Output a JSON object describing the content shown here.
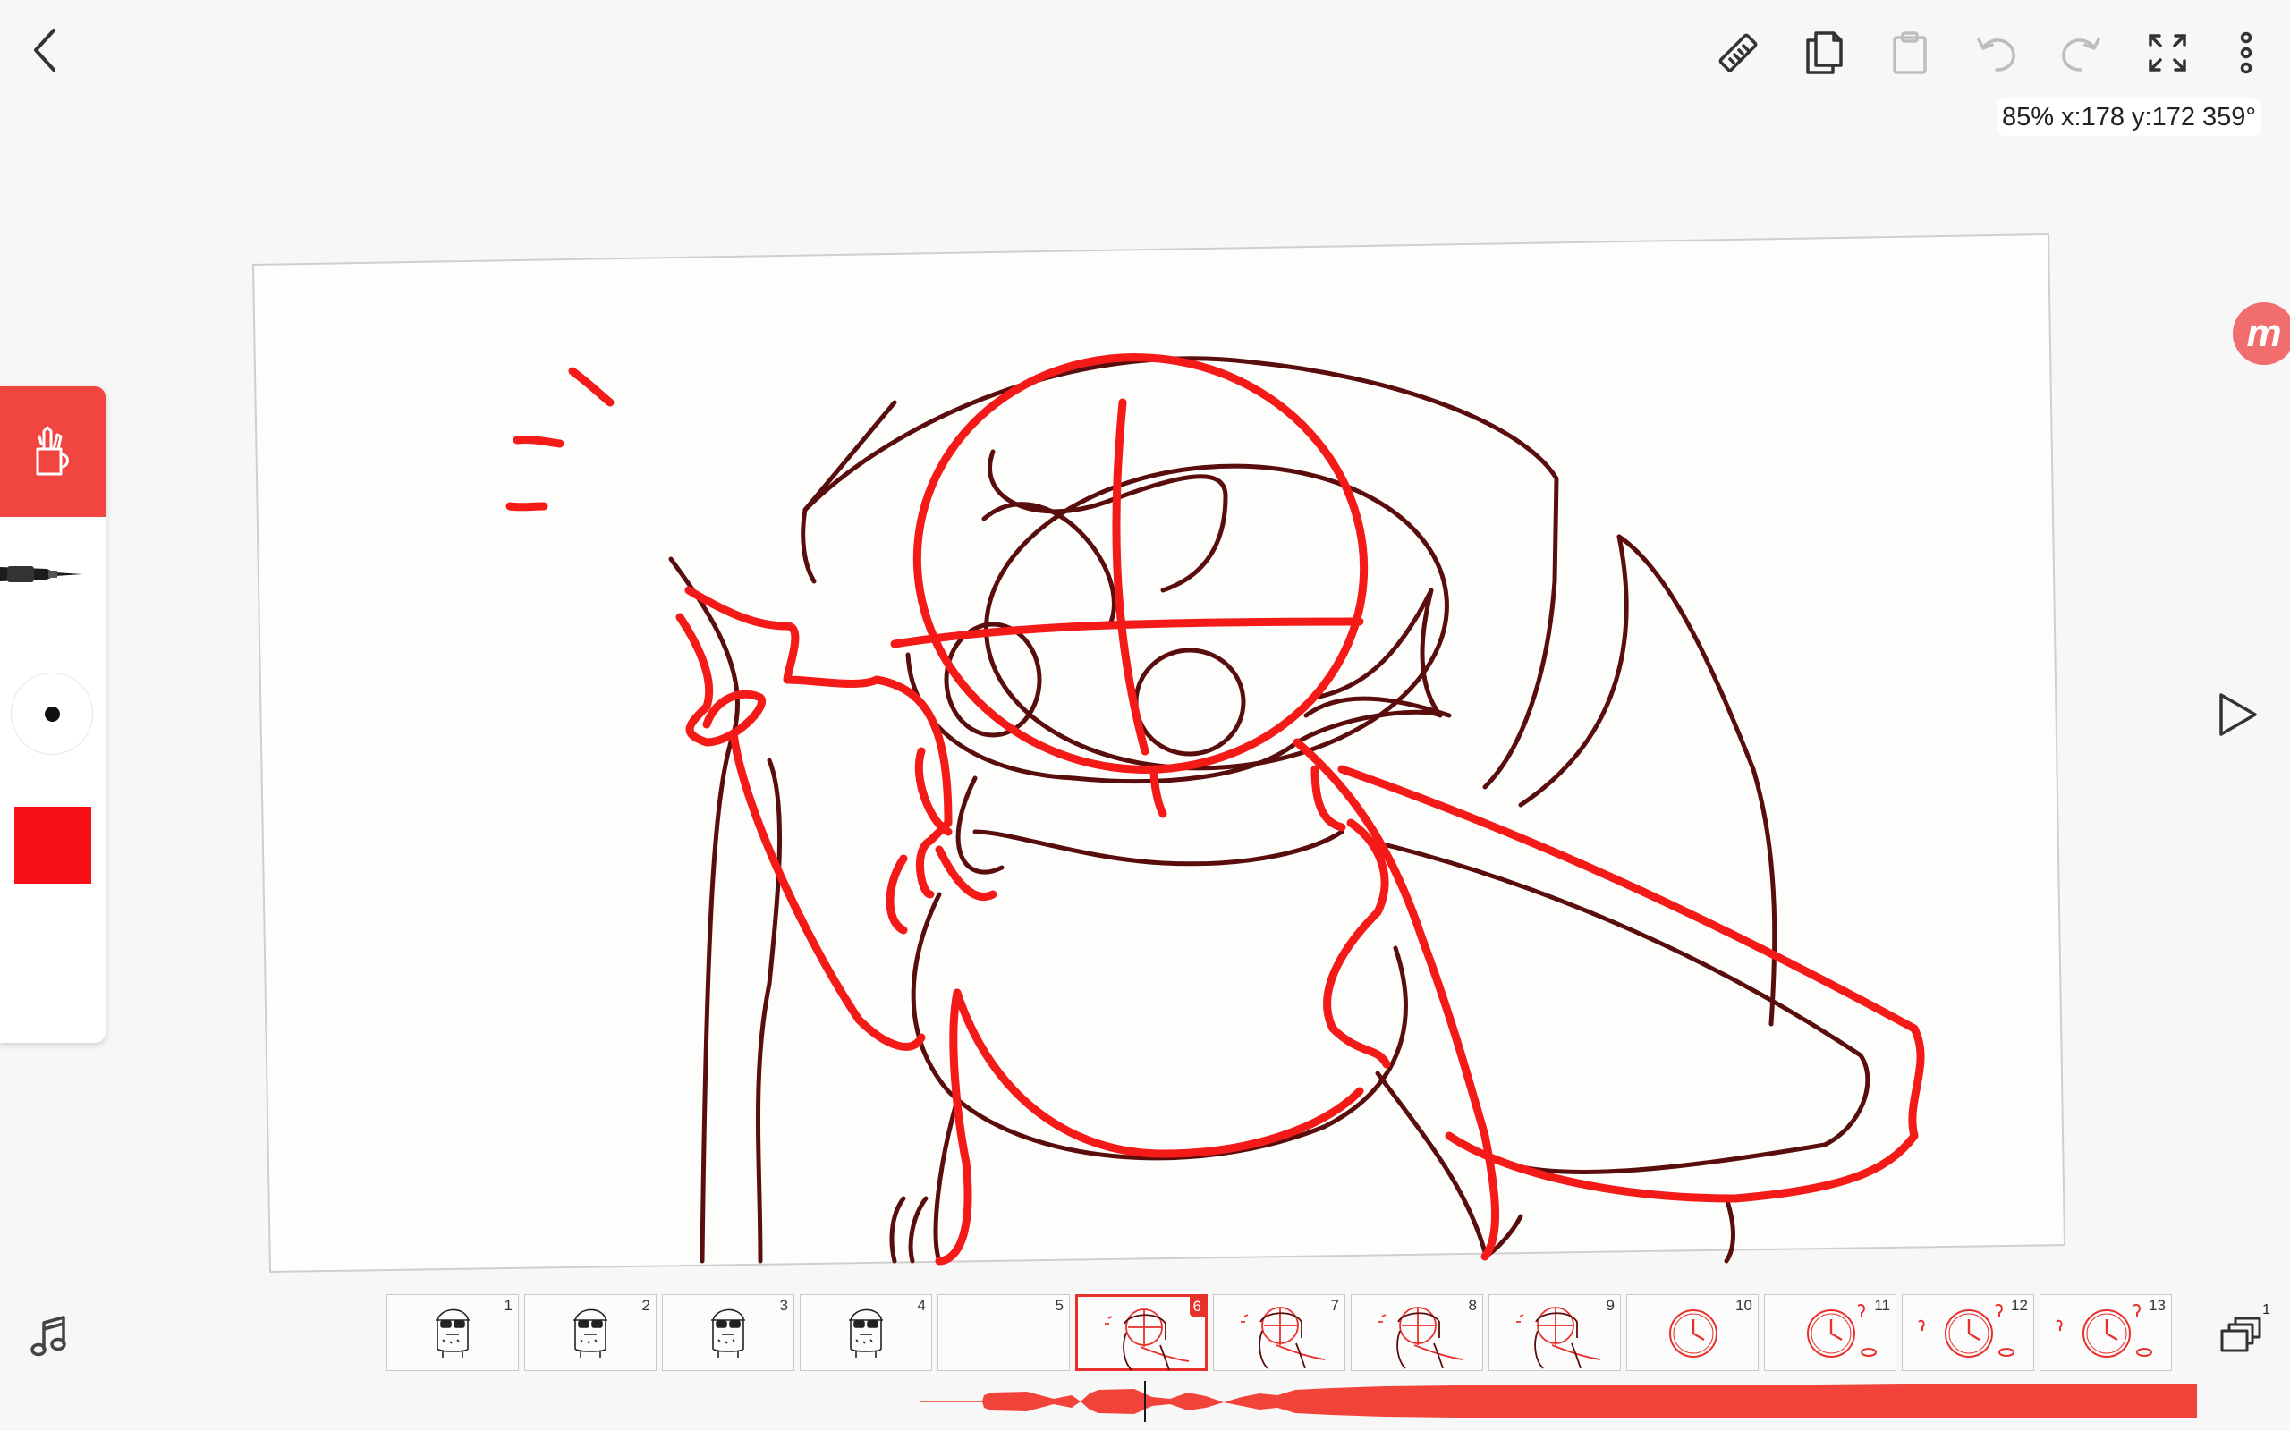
{
  "app": {
    "toolbar": {
      "back": "back",
      "ruler": "ruler",
      "copy": "copy",
      "paste": "paste",
      "undo": "undo",
      "redo": "redo",
      "fullscreen": "fullscreen",
      "more": "more"
    },
    "readout": "85% x:178 y:172 359°",
    "side_badge": "m",
    "brush_color": "#f80f18",
    "accent": "#f0463f"
  },
  "frames": [
    {
      "num": "1",
      "kind": "character"
    },
    {
      "num": "2",
      "kind": "character"
    },
    {
      "num": "3",
      "kind": "character"
    },
    {
      "num": "4",
      "kind": "character"
    },
    {
      "num": "5",
      "kind": "blank"
    },
    {
      "num": "6",
      "kind": "sketch",
      "active": true
    },
    {
      "num": "7",
      "kind": "sketch"
    },
    {
      "num": "8",
      "kind": "sketch"
    },
    {
      "num": "9",
      "kind": "sketch"
    },
    {
      "num": "10",
      "kind": "clock"
    },
    {
      "num": "11",
      "kind": "clock"
    },
    {
      "num": "12",
      "kind": "clock"
    },
    {
      "num": "13",
      "kind": "clock"
    }
  ],
  "layers_count": "1"
}
